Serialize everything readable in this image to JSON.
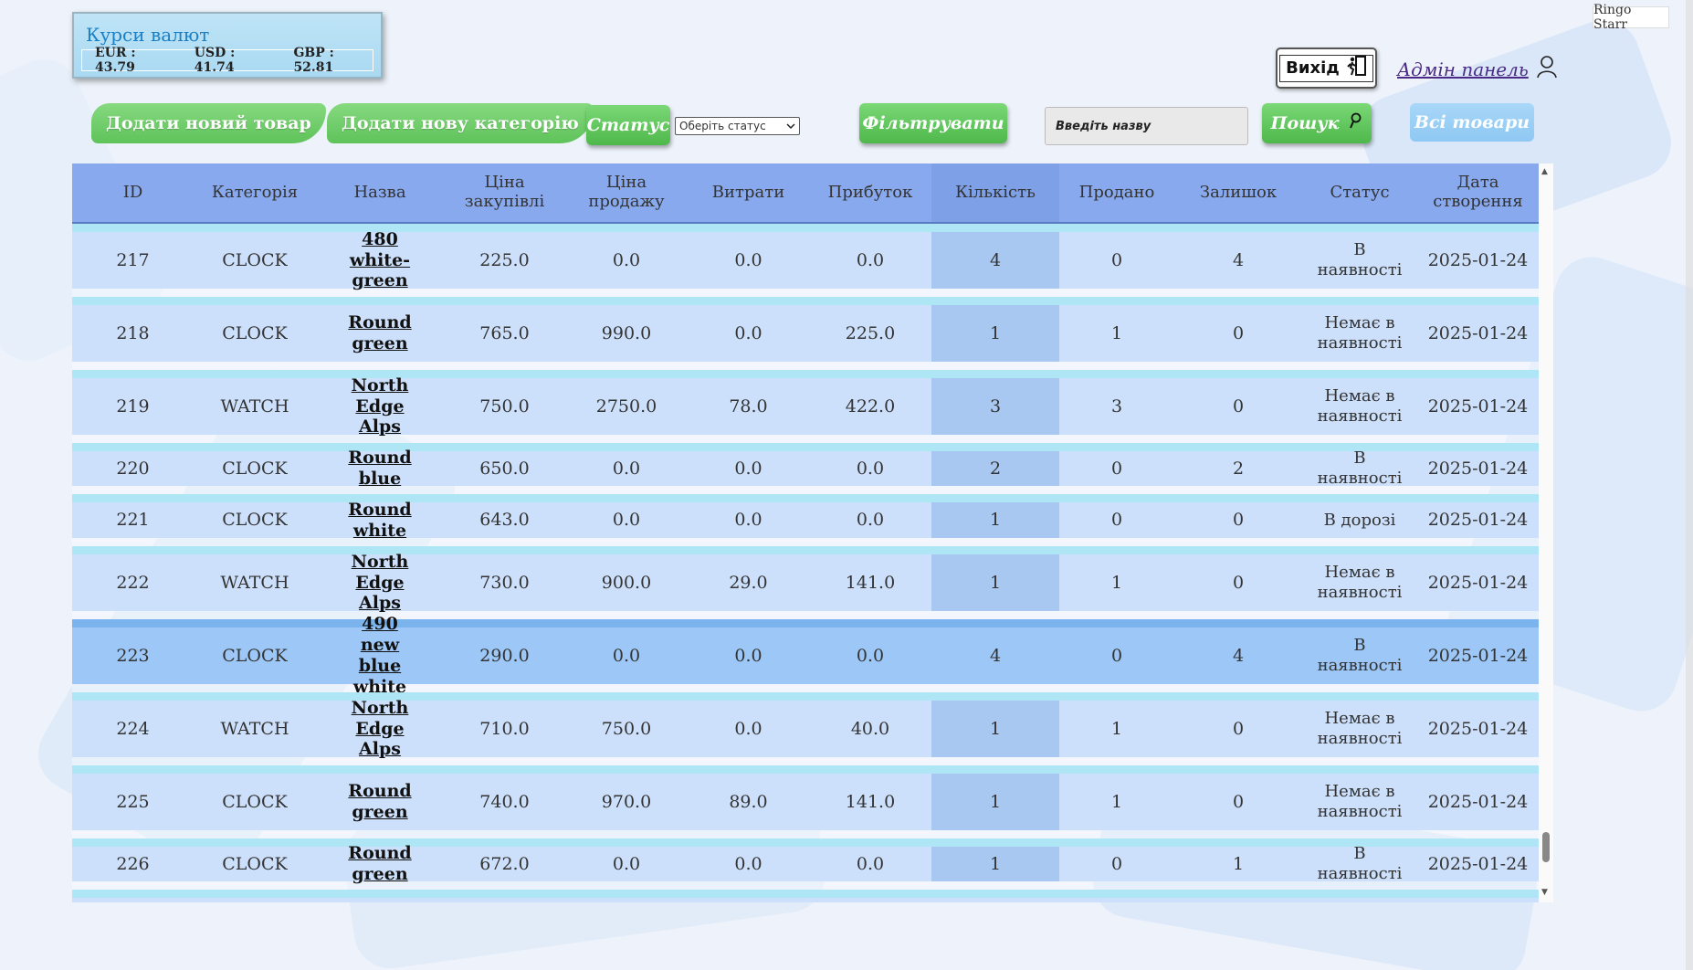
{
  "rates": {
    "title": "Курси валют",
    "eur": "EUR : 43.79",
    "usd": "USD : 41.74",
    "gbp": "GBP : 52.81"
  },
  "user": {
    "name": "Ringo Starr"
  },
  "header": {
    "logout_label": "Вихід",
    "admin_label": "Адмін панель"
  },
  "toolbar": {
    "add_product": "Додати новий товар",
    "add_category": "Додати нову категорію",
    "status_label": "Статус",
    "status_select": "Оберіть статус",
    "filter_label": "Фільтрувати",
    "search_placeholder": "Введіть назву",
    "search_label": "Пошук",
    "all_products": "Всі товари"
  },
  "table": {
    "columns": [
      "ID",
      "Категорія",
      "Назва",
      "Ціна закупівлі",
      "Ціна продажу",
      "Витрати",
      "Прибуток",
      "Кількість",
      "Продано",
      "Залишок",
      "Статус",
      "Дата створення"
    ],
    "rows": [
      {
        "id": "217",
        "category": "CLOCK",
        "name": "480 white-green",
        "buy": "225.0",
        "sell": "0.0",
        "costs": "0.0",
        "profit": "0.0",
        "qty": "4",
        "sold": "0",
        "left": "4",
        "status": "В наявності",
        "date": "2025-01-24"
      },
      {
        "id": "218",
        "category": "CLOCK",
        "name": "Round green",
        "buy": "765.0",
        "sell": "990.0",
        "costs": "0.0",
        "profit": "225.0",
        "qty": "1",
        "sold": "1",
        "left": "0",
        "status": "Немає в наявності",
        "date": "2025-01-24"
      },
      {
        "id": "219",
        "category": "WATCH",
        "name": "North Edge Alps",
        "buy": "750.0",
        "sell": "2750.0",
        "costs": "78.0",
        "profit": "422.0",
        "qty": "3",
        "sold": "3",
        "left": "0",
        "status": "Немає в наявності",
        "date": "2025-01-24"
      },
      {
        "id": "220",
        "category": "CLOCK",
        "name": "Round blue",
        "buy": "650.0",
        "sell": "0.0",
        "costs": "0.0",
        "profit": "0.0",
        "qty": "2",
        "sold": "0",
        "left": "2",
        "status": "В наявності",
        "date": "2025-01-24"
      },
      {
        "id": "221",
        "category": "CLOCK",
        "name": "Round white",
        "buy": "643.0",
        "sell": "0.0",
        "costs": "0.0",
        "profit": "0.0",
        "qty": "1",
        "sold": "0",
        "left": "0",
        "status": "В дорозі",
        "date": "2025-01-24"
      },
      {
        "id": "222",
        "category": "WATCH",
        "name": "North Edge Alps",
        "buy": "730.0",
        "sell": "900.0",
        "costs": "29.0",
        "profit": "141.0",
        "qty": "1",
        "sold": "1",
        "left": "0",
        "status": "Немає в наявності",
        "date": "2025-01-24"
      },
      {
        "id": "223",
        "category": "CLOCK",
        "name": "490 new blue white",
        "buy": "290.0",
        "sell": "0.0",
        "costs": "0.0",
        "profit": "0.0",
        "qty": "4",
        "sold": "0",
        "left": "4",
        "status": "В наявності",
        "date": "2025-01-24"
      },
      {
        "id": "224",
        "category": "WATCH",
        "name": "North Edge Alps",
        "buy": "710.0",
        "sell": "750.0",
        "costs": "0.0",
        "profit": "40.0",
        "qty": "1",
        "sold": "1",
        "left": "0",
        "status": "Немає в наявності",
        "date": "2025-01-24"
      },
      {
        "id": "225",
        "category": "CLOCK",
        "name": "Round green",
        "buy": "740.0",
        "sell": "970.0",
        "costs": "89.0",
        "profit": "141.0",
        "qty": "1",
        "sold": "1",
        "left": "0",
        "status": "Немає в наявності",
        "date": "2025-01-24"
      },
      {
        "id": "226",
        "category": "CLOCK",
        "name": "Round green",
        "buy": "672.0",
        "sell": "0.0",
        "costs": "0.0",
        "profit": "0.0",
        "qty": "1",
        "sold": "0",
        "left": "1",
        "status": "В наявності",
        "date": "2025-01-24"
      }
    ],
    "highlighted_row_id": "223"
  },
  "icons": {
    "logout": "exit-door-icon",
    "admin": "user-icon",
    "search": "magnifier-icon",
    "select": "chevron-down-icon"
  },
  "colors": {
    "header_bg": "#88a9ee",
    "row_bg": "#cde0fb",
    "row_separator": "#aee6f6",
    "highlight_row": "#9dc7f6",
    "green_button": "#5fc35a",
    "all_products_button": "#8ec8f3"
  }
}
